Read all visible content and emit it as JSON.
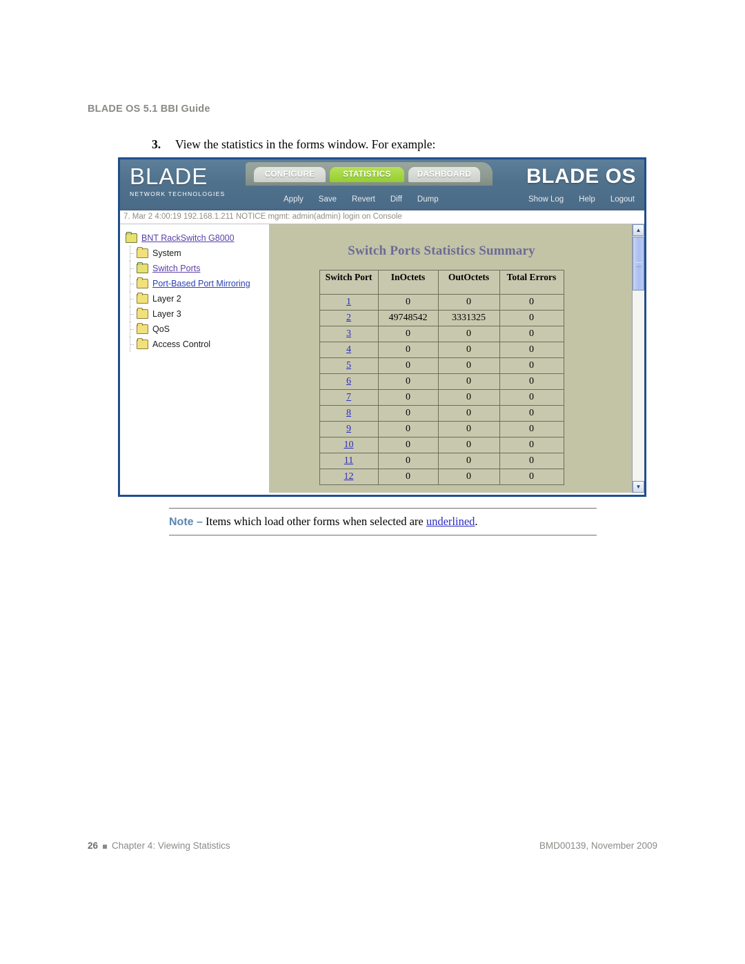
{
  "page": {
    "running_header": "BLADE OS 5.1 BBI Guide",
    "step_number": "3.",
    "step_text": "View the statistics in the forms window. For example:"
  },
  "app": {
    "logo": {
      "word": "BLADE",
      "subtitle": "NETWORK TECHNOLOGIES"
    },
    "brand": "BLADE OS",
    "tabs": [
      {
        "label": "CONFIGURE",
        "active": false
      },
      {
        "label": "STATISTICS",
        "active": true
      },
      {
        "label": "DASHBOARD",
        "active": false
      }
    ],
    "actions": [
      "Apply",
      "Save",
      "Revert",
      "Diff",
      "Dump"
    ],
    "right_actions": [
      "Show Log",
      "Help",
      "Logout"
    ],
    "status_message": "7. Mar  2  4:00:19 192.168.1.211 NOTICE  mgmt: admin(admin) login on Console",
    "tree": [
      {
        "label": "BNT RackSwitch G8000",
        "link": true,
        "level": 0,
        "open": true
      },
      {
        "label": "System",
        "link": false,
        "level": 1,
        "open": false
      },
      {
        "label": "Switch Ports",
        "link": true,
        "level": 1,
        "open": true
      },
      {
        "label": "Port-Based Port Mirroring",
        "link": true,
        "level": 1,
        "open": false
      },
      {
        "label": "Layer 2",
        "link": false,
        "level": 1,
        "open": false
      },
      {
        "label": "Layer 3",
        "link": false,
        "level": 1,
        "open": false
      },
      {
        "label": "QoS",
        "link": false,
        "level": 1,
        "open": false
      },
      {
        "label": "Access Control",
        "link": false,
        "level": 1,
        "open": false
      }
    ],
    "content": {
      "title": "Switch Ports Statistics Summary",
      "table": {
        "headers": [
          "Switch Port",
          "InOctets",
          "OutOctets",
          "Total Errors"
        ],
        "rows": [
          {
            "port": "1",
            "in": "0",
            "out": "0",
            "errors": "0"
          },
          {
            "port": "2",
            "in": "49748542",
            "out": "3331325",
            "errors": "0"
          },
          {
            "port": "3",
            "in": "0",
            "out": "0",
            "errors": "0"
          },
          {
            "port": "4",
            "in": "0",
            "out": "0",
            "errors": "0"
          },
          {
            "port": "5",
            "in": "0",
            "out": "0",
            "errors": "0"
          },
          {
            "port": "6",
            "in": "0",
            "out": "0",
            "errors": "0"
          },
          {
            "port": "7",
            "in": "0",
            "out": "0",
            "errors": "0"
          },
          {
            "port": "8",
            "in": "0",
            "out": "0",
            "errors": "0"
          },
          {
            "port": "9",
            "in": "0",
            "out": "0",
            "errors": "0"
          },
          {
            "port": "10",
            "in": "0",
            "out": "0",
            "errors": "0"
          },
          {
            "port": "11",
            "in": "0",
            "out": "0",
            "errors": "0"
          },
          {
            "port": "12",
            "in": "0",
            "out": "0",
            "errors": "0"
          }
        ]
      }
    },
    "scrollbar": {
      "up_arrow": "▲",
      "down_arrow": "▼"
    }
  },
  "note": {
    "label": "Note –",
    "text_before": " Items which load other forms when selected are ",
    "link_text": "underlined",
    "text_after": "."
  },
  "footer": {
    "page_number": "26",
    "chapter": "Chapter 4: Viewing Statistics",
    "doc_id": "BMD00139, November 2009"
  }
}
